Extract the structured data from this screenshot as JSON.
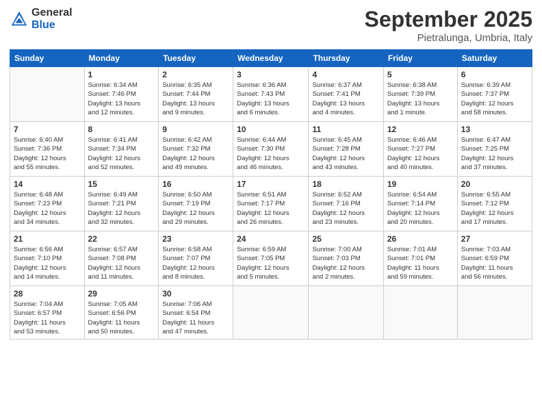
{
  "header": {
    "logo": {
      "general": "General",
      "blue": "Blue"
    },
    "month": "September 2025",
    "location": "Pietralunga, Umbria, Italy"
  },
  "weekdays": [
    "Sunday",
    "Monday",
    "Tuesday",
    "Wednesday",
    "Thursday",
    "Friday",
    "Saturday"
  ],
  "weeks": [
    [
      {
        "date": "",
        "info": ""
      },
      {
        "date": "1",
        "info": "Sunrise: 6:34 AM\nSunset: 7:46 PM\nDaylight: 13 hours\nand 12 minutes."
      },
      {
        "date": "2",
        "info": "Sunrise: 6:35 AM\nSunset: 7:44 PM\nDaylight: 13 hours\nand 9 minutes."
      },
      {
        "date": "3",
        "info": "Sunrise: 6:36 AM\nSunset: 7:43 PM\nDaylight: 13 hours\nand 6 minutes."
      },
      {
        "date": "4",
        "info": "Sunrise: 6:37 AM\nSunset: 7:41 PM\nDaylight: 13 hours\nand 4 minutes."
      },
      {
        "date": "5",
        "info": "Sunrise: 6:38 AM\nSunset: 7:39 PM\nDaylight: 13 hours\nand 1 minute."
      },
      {
        "date": "6",
        "info": "Sunrise: 6:39 AM\nSunset: 7:37 PM\nDaylight: 12 hours\nand 58 minutes."
      }
    ],
    [
      {
        "date": "7",
        "info": "Sunrise: 6:40 AM\nSunset: 7:36 PM\nDaylight: 12 hours\nand 55 minutes."
      },
      {
        "date": "8",
        "info": "Sunrise: 6:41 AM\nSunset: 7:34 PM\nDaylight: 12 hours\nand 52 minutes."
      },
      {
        "date": "9",
        "info": "Sunrise: 6:42 AM\nSunset: 7:32 PM\nDaylight: 12 hours\nand 49 minutes."
      },
      {
        "date": "10",
        "info": "Sunrise: 6:44 AM\nSunset: 7:30 PM\nDaylight: 12 hours\nand 46 minutes."
      },
      {
        "date": "11",
        "info": "Sunrise: 6:45 AM\nSunset: 7:28 PM\nDaylight: 12 hours\nand 43 minutes."
      },
      {
        "date": "12",
        "info": "Sunrise: 6:46 AM\nSunset: 7:27 PM\nDaylight: 12 hours\nand 40 minutes."
      },
      {
        "date": "13",
        "info": "Sunrise: 6:47 AM\nSunset: 7:25 PM\nDaylight: 12 hours\nand 37 minutes."
      }
    ],
    [
      {
        "date": "14",
        "info": "Sunrise: 6:48 AM\nSunset: 7:23 PM\nDaylight: 12 hours\nand 34 minutes."
      },
      {
        "date": "15",
        "info": "Sunrise: 6:49 AM\nSunset: 7:21 PM\nDaylight: 12 hours\nand 32 minutes."
      },
      {
        "date": "16",
        "info": "Sunrise: 6:50 AM\nSunset: 7:19 PM\nDaylight: 12 hours\nand 29 minutes."
      },
      {
        "date": "17",
        "info": "Sunrise: 6:51 AM\nSunset: 7:17 PM\nDaylight: 12 hours\nand 26 minutes."
      },
      {
        "date": "18",
        "info": "Sunrise: 6:52 AM\nSunset: 7:16 PM\nDaylight: 12 hours\nand 23 minutes."
      },
      {
        "date": "19",
        "info": "Sunrise: 6:54 AM\nSunset: 7:14 PM\nDaylight: 12 hours\nand 20 minutes."
      },
      {
        "date": "20",
        "info": "Sunrise: 6:55 AM\nSunset: 7:12 PM\nDaylight: 12 hours\nand 17 minutes."
      }
    ],
    [
      {
        "date": "21",
        "info": "Sunrise: 6:56 AM\nSunset: 7:10 PM\nDaylight: 12 hours\nand 14 minutes."
      },
      {
        "date": "22",
        "info": "Sunrise: 6:57 AM\nSunset: 7:08 PM\nDaylight: 12 hours\nand 11 minutes."
      },
      {
        "date": "23",
        "info": "Sunrise: 6:58 AM\nSunset: 7:07 PM\nDaylight: 12 hours\nand 8 minutes."
      },
      {
        "date": "24",
        "info": "Sunrise: 6:59 AM\nSunset: 7:05 PM\nDaylight: 12 hours\nand 5 minutes."
      },
      {
        "date": "25",
        "info": "Sunrise: 7:00 AM\nSunset: 7:03 PM\nDaylight: 12 hours\nand 2 minutes."
      },
      {
        "date": "26",
        "info": "Sunrise: 7:01 AM\nSunset: 7:01 PM\nDaylight: 11 hours\nand 59 minutes."
      },
      {
        "date": "27",
        "info": "Sunrise: 7:03 AM\nSunset: 6:59 PM\nDaylight: 11 hours\nand 56 minutes."
      }
    ],
    [
      {
        "date": "28",
        "info": "Sunrise: 7:04 AM\nSunset: 6:57 PM\nDaylight: 11 hours\nand 53 minutes."
      },
      {
        "date": "29",
        "info": "Sunrise: 7:05 AM\nSunset: 6:56 PM\nDaylight: 11 hours\nand 50 minutes."
      },
      {
        "date": "30",
        "info": "Sunrise: 7:06 AM\nSunset: 6:54 PM\nDaylight: 11 hours\nand 47 minutes."
      },
      {
        "date": "",
        "info": ""
      },
      {
        "date": "",
        "info": ""
      },
      {
        "date": "",
        "info": ""
      },
      {
        "date": "",
        "info": ""
      }
    ]
  ]
}
